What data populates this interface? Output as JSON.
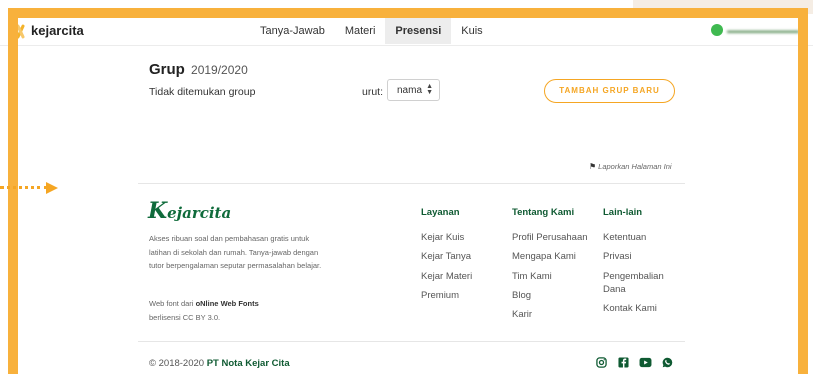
{
  "header": {
    "brand": "kejarcita",
    "nav": [
      {
        "label": "Tanya-Jawab",
        "active": false
      },
      {
        "label": "Materi",
        "active": false
      },
      {
        "label": "Presensi",
        "active": true
      },
      {
        "label": "Kuis",
        "active": false
      }
    ]
  },
  "main": {
    "title": "Grup",
    "year": "2019/2020",
    "empty_message": "Tidak ditemukan group",
    "sort_label": "urut:",
    "sort_value": "nama",
    "add_button": "TAMBAH GRUP BARU",
    "report_link": "Laporkan Halaman Ini"
  },
  "footer": {
    "brand": "kejarcita",
    "description": "Akses ribuan soal dan pembahasan gratis untuk latihan di sekolah dan rumah. Tanya-jawab dengan tutor berpengalaman seputar permasalahan belajar.",
    "fonts_prefix": "Web font dari ",
    "fonts_name": "oNline Web Fonts",
    "fonts_license": "berlisensi CC BY 3.0.",
    "columns": [
      {
        "title": "Layanan",
        "links": [
          "Kejar Kuis",
          "Kejar Tanya",
          "Kejar Materi",
          "Premium"
        ]
      },
      {
        "title": "Tentang Kami",
        "links": [
          "Profil Perusahaan",
          "Mengapa Kami",
          "Tim Kami",
          "Blog",
          "Karir"
        ]
      },
      {
        "title": "Lain-lain",
        "links": [
          "Ketentuan",
          "Privasi",
          "Pengembalian Dana",
          "Kontak Kami"
        ]
      }
    ],
    "copyright_prefix": "© 2018-2020 ",
    "copyright_company": "PT Nota Kejar Cita",
    "social_icons": [
      "instagram-icon",
      "facebook-icon",
      "youtube-icon",
      "whatsapp-icon"
    ]
  },
  "colors": {
    "frame": "#f8b13c",
    "accent": "#f5a623",
    "brand_green": "#0f6b3b"
  }
}
